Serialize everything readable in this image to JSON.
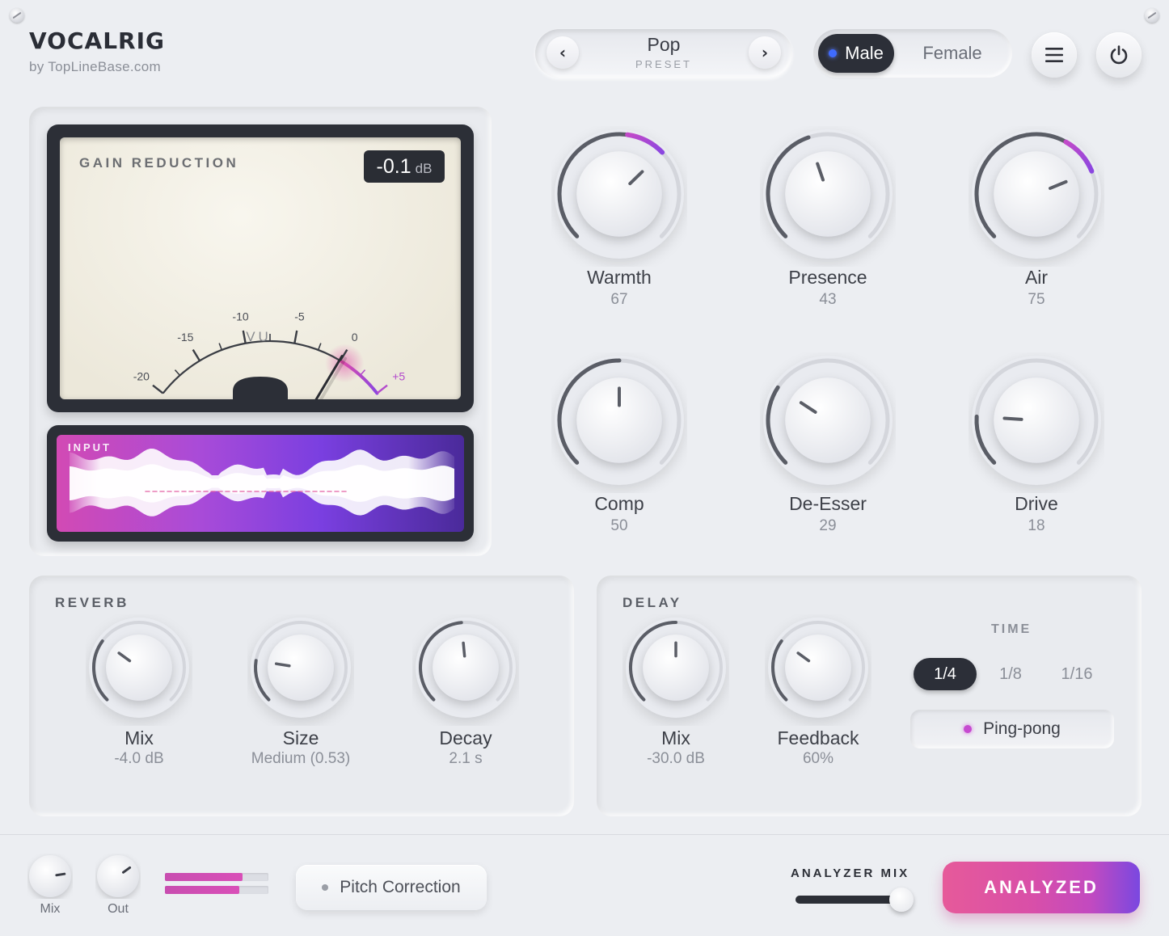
{
  "brand": {
    "name": "VOCALRIG",
    "by": "by TopLineBase.com"
  },
  "preset": {
    "name": "Pop",
    "label": "PRESET",
    "prev": "‹",
    "next": "›"
  },
  "voice": {
    "male": "Male",
    "female": "Female",
    "selected": "Male"
  },
  "meter": {
    "title": "GAIN REDUCTION",
    "readout_value": "-0.1",
    "readout_unit": "dB",
    "scale": [
      "-20",
      "-15",
      "-10",
      "-5",
      "0",
      "+5"
    ],
    "vu_label": "VU",
    "needle_db": -0.1
  },
  "input": {
    "label": "INPUT"
  },
  "knobs": [
    {
      "label": "Warmth",
      "value": "67",
      "level": 67
    },
    {
      "label": "Presence",
      "value": "43",
      "level": 43
    },
    {
      "label": "Air",
      "value": "75",
      "level": 75
    },
    {
      "label": "Comp",
      "value": "50",
      "level": 50
    },
    {
      "label": "De-Esser",
      "value": "29",
      "level": 29
    },
    {
      "label": "Drive",
      "value": "18",
      "level": 18
    }
  ],
  "reverb": {
    "title": "REVERB",
    "knobs": [
      {
        "label": "Mix",
        "value": "-4.0 dB",
        "level": 30
      },
      {
        "label": "Size",
        "value": "Medium (0.53)",
        "level": 20
      },
      {
        "label": "Decay",
        "value": "2.1 s",
        "level": 48
      }
    ]
  },
  "delay": {
    "title": "DELAY",
    "knobs": [
      {
        "label": "Mix",
        "value": "-30.0 dB",
        "level": 50
      },
      {
        "label": "Feedback",
        "value": "60%",
        "level": 30
      }
    ],
    "time_title": "TIME",
    "time_options": [
      "1/4",
      "1/8",
      "1/16"
    ],
    "time_selected": "1/4",
    "pingpong": "Ping-pong"
  },
  "footer": {
    "mix_label": "Mix",
    "out_label": "Out",
    "mix_level": 80,
    "out_level": 70,
    "bar_levels": [
      0.75,
      0.72
    ],
    "pitch": "Pitch Correction",
    "analyzer_title": "ANALYZER MIX",
    "analyzer_level": 0.98,
    "analyzed": "ANALYZED"
  },
  "colors": {
    "accent": "#9a48e0",
    "accent_pink": "#d94fb8",
    "dark": "#2c2f38"
  }
}
